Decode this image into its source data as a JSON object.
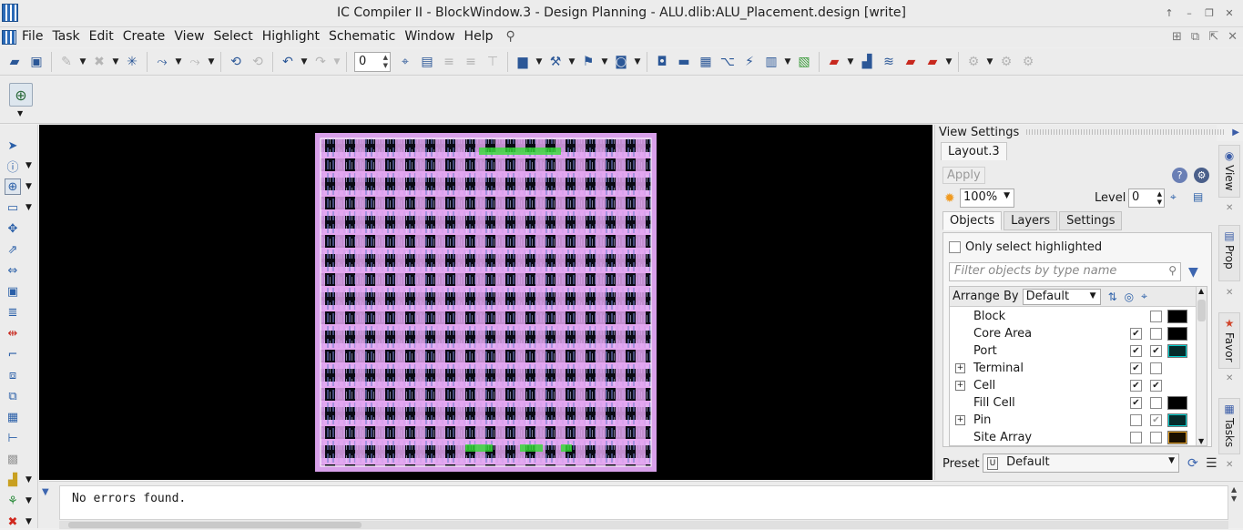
{
  "window": {
    "title": "IC Compiler II - BlockWindow.3 - Design Planning - ALU.dlib:ALU_Placement.design [write]",
    "controls": [
      "↑",
      "–",
      "❐",
      "✕"
    ]
  },
  "menubar": {
    "items": [
      "File",
      "Task",
      "Edit",
      "Create",
      "View",
      "Select",
      "Highlight",
      "Schematic",
      "Window",
      "Help"
    ]
  },
  "toolbar": {
    "spin_value": "0"
  },
  "view_settings": {
    "title": "View Settings",
    "layout_tab": "Layout.3",
    "apply_label": "Apply",
    "zoom_value": "100%",
    "level_label": "Level",
    "level_value": "0",
    "tabs": [
      "Objects",
      "Layers",
      "Settings"
    ],
    "active_tab": "Objects",
    "only_select_highlighted": "Only select highlighted",
    "filter_placeholder": "Filter objects by type name",
    "arrange_by_label": "Arrange By",
    "arrange_by_value": "Default",
    "objects": [
      {
        "name": "Block",
        "expandable": false,
        "visible": null,
        "selectable": false,
        "color": "#000000"
      },
      {
        "name": "Core Area",
        "expandable": false,
        "visible": true,
        "selectable": false,
        "color": "#000000"
      },
      {
        "name": "Port",
        "expandable": false,
        "visible": true,
        "selectable": true,
        "color": "#00cccc"
      },
      {
        "name": "Terminal",
        "expandable": true,
        "visible": true,
        "selectable": false,
        "color": null
      },
      {
        "name": "Cell",
        "expandable": true,
        "visible": true,
        "selectable": true,
        "color": null
      },
      {
        "name": "Fill Cell",
        "expandable": false,
        "visible": true,
        "selectable": false,
        "color": "#000000"
      },
      {
        "name": "Pin",
        "expandable": true,
        "visible": false,
        "selectable": true,
        "color": "#00cccc"
      },
      {
        "name": "Site Array",
        "expandable": false,
        "visible": false,
        "selectable": false,
        "color": "#e8a020"
      }
    ],
    "preset_label": "Preset",
    "preset_value": "Default",
    "preset_badge": "U"
  },
  "side_tabs": [
    "View",
    "Prop",
    "Favor",
    "Tasks"
  ],
  "console": {
    "message": "No errors found."
  }
}
